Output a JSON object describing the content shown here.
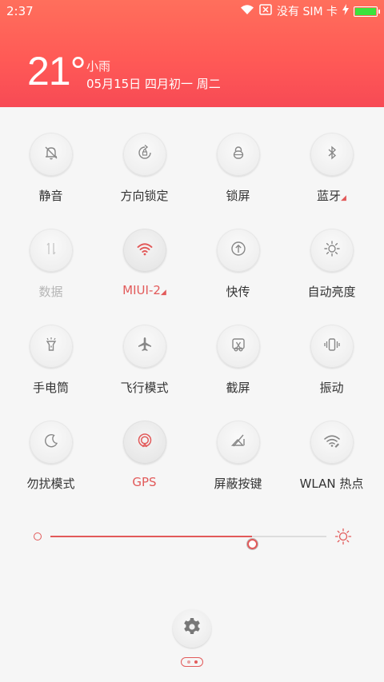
{
  "status_bar": {
    "time": "2:37",
    "carrier": "没有 SIM 卡"
  },
  "weather": {
    "temperature": "21°",
    "condition": "小雨",
    "date": "05月15日 四月初一 周二"
  },
  "toggles": [
    {
      "label": "静音",
      "icon": "silent-bell-icon",
      "state": "normal"
    },
    {
      "label": "方向锁定",
      "icon": "rotation-lock-icon",
      "state": "normal"
    },
    {
      "label": "锁屏",
      "icon": "lock-icon",
      "state": "normal"
    },
    {
      "label": "蓝牙",
      "icon": "bluetooth-icon",
      "state": "normal",
      "has_more": true
    },
    {
      "label": "数据",
      "icon": "mobile-data-icon",
      "state": "disabled"
    },
    {
      "label": "MIUI-2",
      "icon": "wifi-icon",
      "state": "active",
      "has_more": true
    },
    {
      "label": "快传",
      "icon": "quick-share-icon",
      "state": "normal"
    },
    {
      "label": "自动亮度",
      "icon": "auto-brightness-icon",
      "state": "normal"
    },
    {
      "label": "手电筒",
      "icon": "flashlight-icon",
      "state": "normal"
    },
    {
      "label": "飞行模式",
      "icon": "airplane-icon",
      "state": "normal"
    },
    {
      "label": "截屏",
      "icon": "screenshot-icon",
      "state": "normal"
    },
    {
      "label": "振动",
      "icon": "vibrate-icon",
      "state": "normal"
    },
    {
      "label": "勿扰模式",
      "icon": "moon-icon",
      "state": "normal"
    },
    {
      "label": "GPS",
      "icon": "gps-icon",
      "state": "active"
    },
    {
      "label": "屏蔽按键",
      "icon": "block-keys-icon",
      "state": "normal"
    },
    {
      "label": "WLAN 热点",
      "icon": "hotspot-icon",
      "state": "normal"
    }
  ],
  "brightness": {
    "level": 0.73
  },
  "colors": {
    "accent": "#e25a5a",
    "header_top": "#ff6f5c",
    "header_bottom": "#f74a55",
    "battery": "#3ce23c"
  },
  "pager": {
    "pages": 2,
    "current": 1
  }
}
